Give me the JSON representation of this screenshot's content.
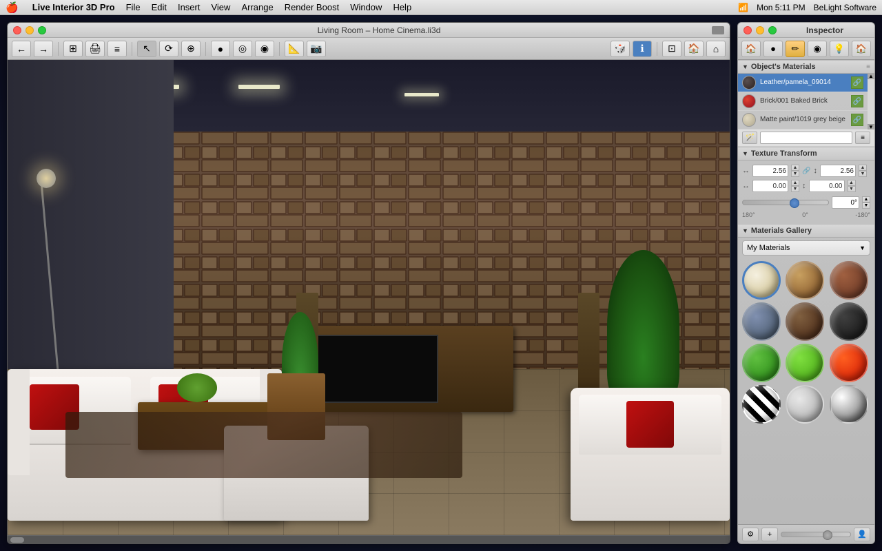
{
  "menubar": {
    "apple": "🍎",
    "appname": "Live Interior 3D Pro",
    "menus": [
      "File",
      "Edit",
      "Insert",
      "View",
      "Arrange",
      "Render Boost",
      "Window",
      "Help"
    ],
    "right": [
      "Mon 5:11 PM",
      "BeLight Software"
    ]
  },
  "viewport": {
    "title": "Living Room – Home Cinema.li3d",
    "toolbar_buttons": [
      "←",
      "→",
      "⊞",
      "🖨",
      "≡",
      "↖",
      "⟳",
      "⊕",
      "●",
      "◎",
      "◍",
      "⚡",
      "📷",
      "🔧",
      "ℹ",
      "⊡",
      "⊟",
      "⌂"
    ]
  },
  "inspector": {
    "title": "Inspector",
    "tabs": [
      "🏠",
      "●",
      "✏",
      "◉",
      "💡",
      "🏠"
    ],
    "active_tab_index": 2,
    "sections": {
      "objects_materials": {
        "label": "Object's Materials",
        "materials": [
          {
            "name": "Leather/pamela_09014",
            "color": "#3a3a3a",
            "selected": true
          },
          {
            "name": "Brick/001 Baked Brick",
            "color": "#c03020"
          },
          {
            "name": "Matte paint/1019 grey beige",
            "color": "#d4c8b0"
          }
        ]
      },
      "texture_transform": {
        "label": "Texture Transform",
        "scale_x": "2.56",
        "scale_y": "2.56",
        "offset_x": "0.00",
        "offset_y": "0.00",
        "angle_value": "0°",
        "angle_min": "180°",
        "angle_mid": "0°",
        "angle_max": "-180°"
      },
      "materials_gallery": {
        "label": "Materials Gallery",
        "dropdown_value": "My Materials",
        "materials_grid": [
          {
            "label": "cream-ball",
            "bg": "radial-gradient(circle at 35% 35%, #f5f0e0, #c8b880)",
            "selected": true
          },
          {
            "label": "wood-ball",
            "bg": "radial-gradient(circle at 35% 35%, #c8a060, #7a4a20)"
          },
          {
            "label": "brick-ball",
            "bg": "radial-gradient(circle at 35% 35%, #a06040, #603020)"
          },
          {
            "label": "water-ball",
            "bg": "radial-gradient(circle at 35% 35%, #8090b0, #405060)"
          },
          {
            "label": "dark-wood-ball",
            "bg": "radial-gradient(circle at 35% 35%, #806040, #402010)"
          },
          {
            "label": "dark-ball",
            "bg": "radial-gradient(circle at 35% 35%, #404040, #101010)"
          },
          {
            "label": "green-ball",
            "bg": "radial-gradient(circle at 35% 35%, #60c040, #208010)"
          },
          {
            "label": "bright-green-ball",
            "bg": "radial-gradient(circle at 35% 35%, #80e040, #40a010)"
          },
          {
            "label": "fire-ball",
            "bg": "radial-gradient(circle at 35% 35%, #e04020, #a01000)"
          },
          {
            "label": "zebra-ball",
            "bg": "repeating-linear-gradient(45deg, #000 0px, #000 8px, #fff 8px, #fff 16px)"
          },
          {
            "label": "spots-ball",
            "bg": "radial-gradient(circle at 35% 35%, #e0e0e0, #a0a0a0)"
          },
          {
            "label": "chrome-ball",
            "bg": "radial-gradient(circle at 35% 35%, #ffffff, #888888, #333333)"
          }
        ]
      }
    }
  }
}
